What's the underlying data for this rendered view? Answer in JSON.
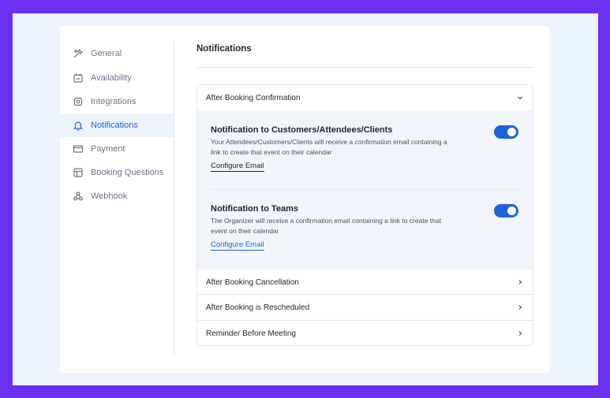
{
  "sidebar": {
    "items": [
      {
        "label": "General",
        "icon": "tools-icon"
      },
      {
        "label": "Availability",
        "icon": "calendar-icon"
      },
      {
        "label": "Integrations",
        "icon": "integrations-icon"
      },
      {
        "label": "Notifications",
        "icon": "bell-icon",
        "active": true
      },
      {
        "label": "Payment",
        "icon": "card-icon"
      },
      {
        "label": "Booking Questions",
        "icon": "form-icon"
      },
      {
        "label": "Webhook",
        "icon": "webhook-icon"
      }
    ]
  },
  "main": {
    "title": "Notifications",
    "sections": [
      {
        "label": "After Booking Confirmation",
        "expanded": true
      },
      {
        "label": "After Booking Cancellation",
        "expanded": false
      },
      {
        "label": "After Booking is Rescheduled",
        "expanded": false
      },
      {
        "label": "Reminder Before Meeting",
        "expanded": false
      }
    ],
    "notifications": [
      {
        "title": "Notification to Customers/Attendees/Clients",
        "description": "Your Attendees/Customers/Clients will receive a confirmation email containing a link to create that event on their calendar",
        "link": "Configure Email",
        "enabled": true
      },
      {
        "title": "Notification to Teams",
        "description": "The Organizer will receive a confirmation email containing a link to create that event on their calendar",
        "link": "Configure Email",
        "enabled": true
      }
    ]
  },
  "colors": {
    "accent": "#1e63d6",
    "background": "#6a2ff0",
    "frame": "#edf3fa"
  }
}
